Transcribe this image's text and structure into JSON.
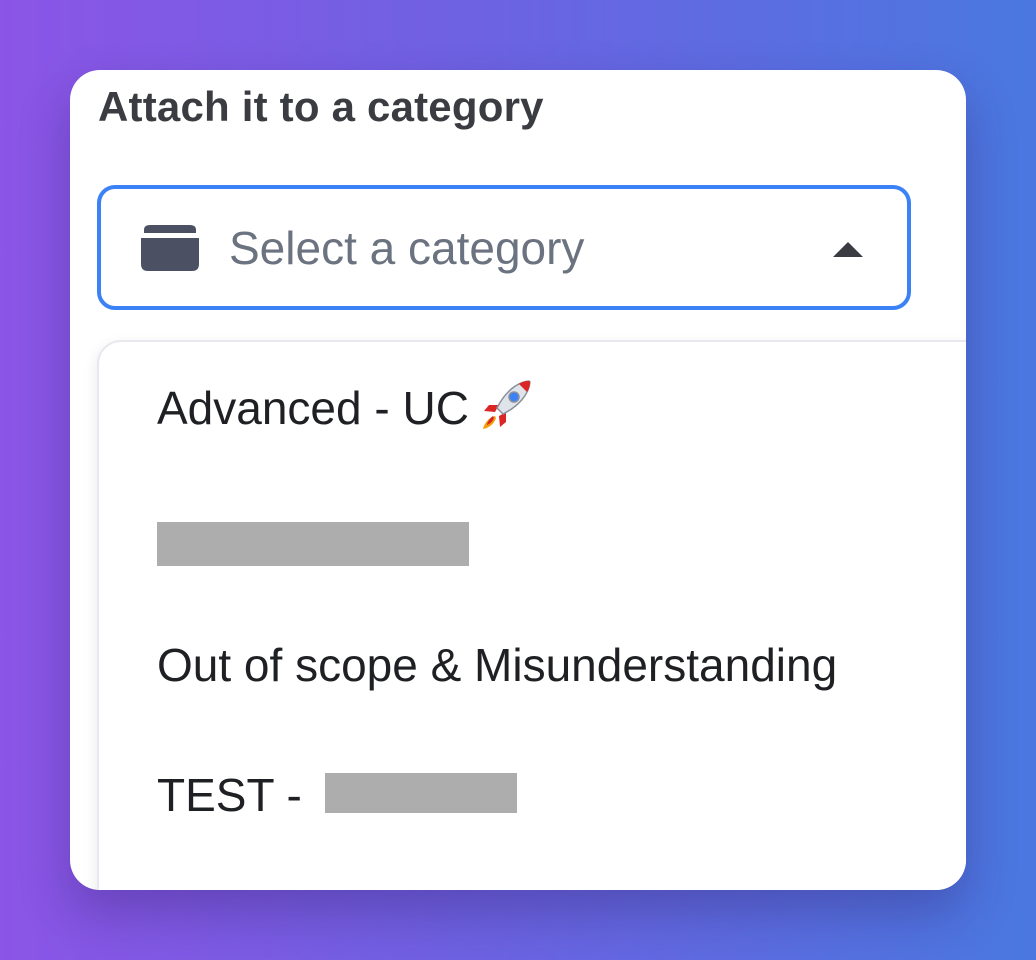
{
  "form": {
    "label": "Attach it to a category",
    "select": {
      "placeholder": "Select a category",
      "leading_icon": "folder-icon",
      "trailing_icon": "caret-up-icon",
      "expanded": true,
      "focus_color": "#3b82f6"
    }
  },
  "dropdown": {
    "options": [
      {
        "label": "Advanced - UC",
        "icon": "rocket-icon"
      },
      {
        "label": "",
        "redacted": true
      },
      {
        "label": "Out of scope & Misunderstanding"
      },
      {
        "label": "TEST - ",
        "redacted_suffix": true
      }
    ]
  },
  "colors": {
    "background_start": "#8b55e6",
    "background_end": "#4a78e0",
    "redaction": "#adadad"
  }
}
